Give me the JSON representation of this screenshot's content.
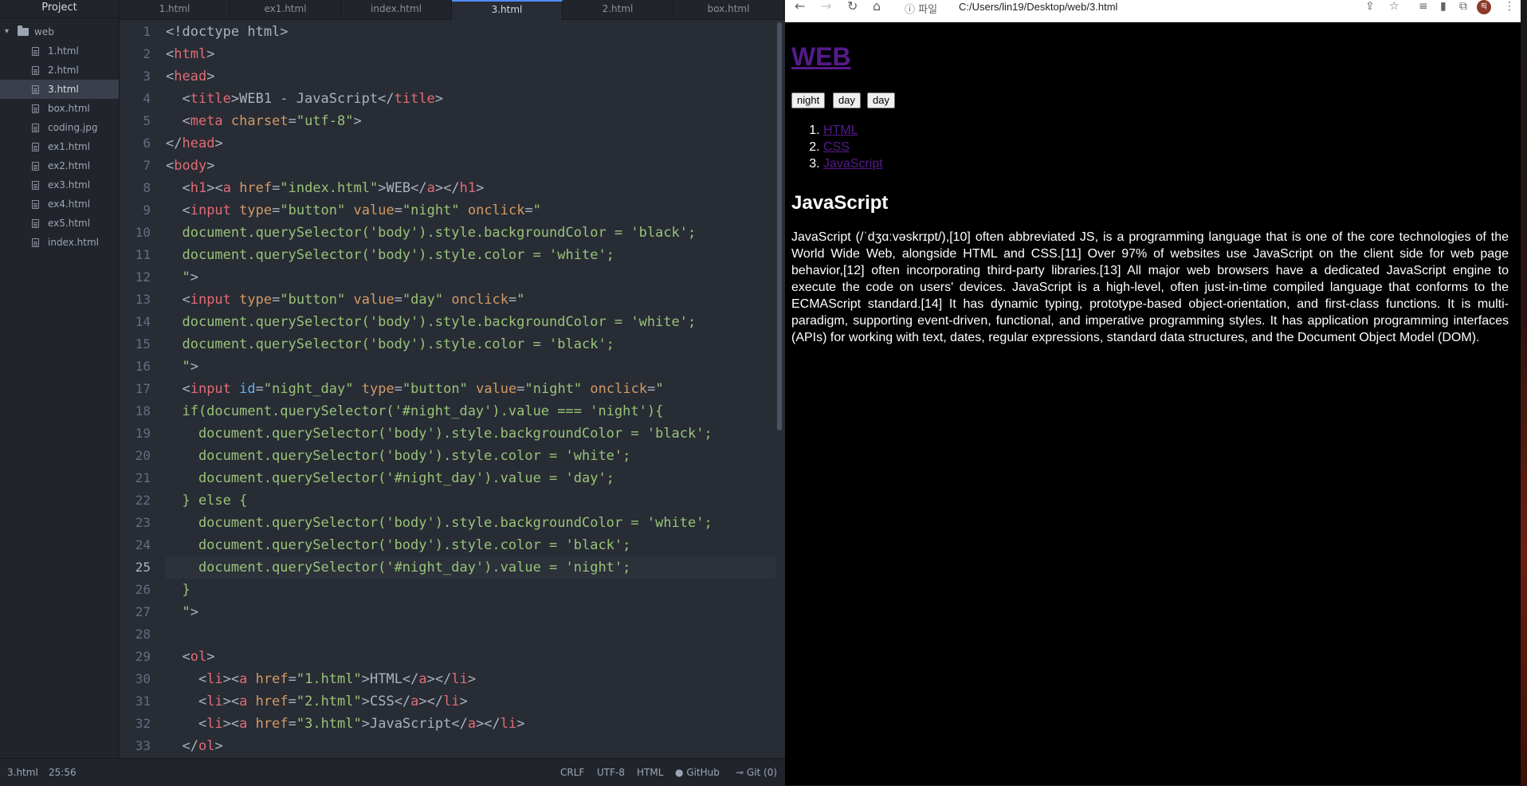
{
  "editor": {
    "tree_header": "Project",
    "folder": "web",
    "files": [
      "1.html",
      "2.html",
      "3.html",
      "box.html",
      "coding.jpg",
      "ex1.html",
      "ex2.html",
      "ex3.html",
      "ex4.html",
      "ex5.html",
      "index.html"
    ],
    "selected_file": "3.html",
    "tabs": [
      "1.html",
      "ex1.html",
      "index.html",
      "3.html",
      "2.html",
      "box.html"
    ],
    "active_tab": "3.html",
    "line_numbers": [
      "1",
      "2",
      "3",
      "4",
      "5",
      "6",
      "7",
      "8",
      "9",
      "10",
      "11",
      "12",
      "13",
      "14",
      "15",
      "16",
      "17",
      "18",
      "19",
      "20",
      "21",
      "22",
      "23",
      "24",
      "25",
      "26",
      "27",
      "28",
      "29",
      "30",
      "31",
      "32",
      "33"
    ],
    "current_line": "25",
    "code": [
      [
        [
          "pl",
          "<!doctype html>"
        ]
      ],
      [
        [
          "pl",
          "<"
        ],
        [
          "tg",
          "html"
        ],
        [
          "pl",
          ">"
        ]
      ],
      [
        [
          "pl",
          "<"
        ],
        [
          "tg",
          "head"
        ],
        [
          "pl",
          ">"
        ]
      ],
      [
        [
          "pl",
          "  <"
        ],
        [
          "tg",
          "title"
        ],
        [
          "pl",
          ">WEB1 - JavaScript</"
        ],
        [
          "tg",
          "title"
        ],
        [
          "pl",
          ">"
        ]
      ],
      [
        [
          "pl",
          "  <"
        ],
        [
          "tg",
          "meta"
        ],
        [
          "pl",
          " "
        ],
        [
          "at",
          "charset"
        ],
        [
          "pl",
          "="
        ],
        [
          "st",
          "\"utf-8\""
        ],
        [
          "pl",
          ">"
        ]
      ],
      [
        [
          "pl",
          "</"
        ],
        [
          "tg",
          "head"
        ],
        [
          "pl",
          ">"
        ]
      ],
      [
        [
          "pl",
          "<"
        ],
        [
          "tg",
          "body"
        ],
        [
          "pl",
          ">"
        ]
      ],
      [
        [
          "pl",
          "  <"
        ],
        [
          "tg",
          "h1"
        ],
        [
          "pl",
          "><"
        ],
        [
          "tg",
          "a"
        ],
        [
          "pl",
          " "
        ],
        [
          "at",
          "href"
        ],
        [
          "pl",
          "="
        ],
        [
          "st",
          "\"index.html\""
        ],
        [
          "pl",
          ">WEB</"
        ],
        [
          "tg",
          "a"
        ],
        [
          "pl",
          "></"
        ],
        [
          "tg",
          "h1"
        ],
        [
          "pl",
          ">"
        ]
      ],
      [
        [
          "pl",
          "  <"
        ],
        [
          "tg",
          "input"
        ],
        [
          "pl",
          " "
        ],
        [
          "at",
          "type"
        ],
        [
          "pl",
          "="
        ],
        [
          "st",
          "\"button\""
        ],
        [
          "pl",
          " "
        ],
        [
          "at",
          "value"
        ],
        [
          "pl",
          "="
        ],
        [
          "st",
          "\"night\""
        ],
        [
          "pl",
          " "
        ],
        [
          "at",
          "onclick"
        ],
        [
          "pl",
          "="
        ],
        [
          "st",
          "\""
        ]
      ],
      [
        [
          "st",
          "  document.querySelector('body').style.backgroundColor = 'black';"
        ]
      ],
      [
        [
          "st",
          "  document.querySelector('body').style.color = 'white';"
        ]
      ],
      [
        [
          "st",
          "  \""
        ],
        [
          "pl",
          ">"
        ]
      ],
      [
        [
          "pl",
          "  <"
        ],
        [
          "tg",
          "input"
        ],
        [
          "pl",
          " "
        ],
        [
          "at",
          "type"
        ],
        [
          "pl",
          "="
        ],
        [
          "st",
          "\"button\""
        ],
        [
          "pl",
          " "
        ],
        [
          "at",
          "value"
        ],
        [
          "pl",
          "="
        ],
        [
          "st",
          "\"day\""
        ],
        [
          "pl",
          " "
        ],
        [
          "at",
          "onclick"
        ],
        [
          "pl",
          "="
        ],
        [
          "st",
          "\""
        ]
      ],
      [
        [
          "st",
          "  document.querySelector('body').style.backgroundColor = 'white';"
        ]
      ],
      [
        [
          "st",
          "  document.querySelector('body').style.color = 'black';"
        ]
      ],
      [
        [
          "st",
          "  \""
        ],
        [
          "pl",
          ">"
        ]
      ],
      [
        [
          "pl",
          "  <"
        ],
        [
          "tg",
          "input"
        ],
        [
          "pl",
          " "
        ],
        [
          "id",
          "id"
        ],
        [
          "pl",
          "="
        ],
        [
          "st",
          "\"night_day\""
        ],
        [
          "pl",
          " "
        ],
        [
          "at",
          "type"
        ],
        [
          "pl",
          "="
        ],
        [
          "st",
          "\"button\""
        ],
        [
          "pl",
          " "
        ],
        [
          "at",
          "value"
        ],
        [
          "pl",
          "="
        ],
        [
          "st",
          "\"night\""
        ],
        [
          "pl",
          " "
        ],
        [
          "at",
          "onclick"
        ],
        [
          "pl",
          "="
        ],
        [
          "st",
          "\""
        ]
      ],
      [
        [
          "st",
          "  if(document.querySelector('#night_day').value === 'night'){"
        ]
      ],
      [
        [
          "st",
          "    document.querySelector('body').style.backgroundColor = 'black';"
        ]
      ],
      [
        [
          "st",
          "    document.querySelector('body').style.color = 'white';"
        ]
      ],
      [
        [
          "st",
          "    document.querySelector('#night_day').value = 'day';"
        ]
      ],
      [
        [
          "st",
          "  } else {"
        ]
      ],
      [
        [
          "st",
          "    document.querySelector('body').style.backgroundColor = 'white';"
        ]
      ],
      [
        [
          "st",
          "    document.querySelector('body').style.color = 'black';"
        ]
      ],
      [
        [
          "st",
          "    document.querySelector('#night_day').value = 'night';"
        ]
      ],
      [
        [
          "st",
          "  }"
        ]
      ],
      [
        [
          "st",
          "  \""
        ],
        [
          "pl",
          ">"
        ]
      ],
      [],
      [
        [
          "pl",
          "  <"
        ],
        [
          "tg",
          "ol"
        ],
        [
          "pl",
          ">"
        ]
      ],
      [
        [
          "pl",
          "    <"
        ],
        [
          "tg",
          "li"
        ],
        [
          "pl",
          "><"
        ],
        [
          "tg",
          "a"
        ],
        [
          "pl",
          " "
        ],
        [
          "at",
          "href"
        ],
        [
          "pl",
          "="
        ],
        [
          "st",
          "\"1.html\""
        ],
        [
          "pl",
          ">HTML</"
        ],
        [
          "tg",
          "a"
        ],
        [
          "pl",
          "></"
        ],
        [
          "tg",
          "li"
        ],
        [
          "pl",
          ">"
        ]
      ],
      [
        [
          "pl",
          "    <"
        ],
        [
          "tg",
          "li"
        ],
        [
          "pl",
          "><"
        ],
        [
          "tg",
          "a"
        ],
        [
          "pl",
          " "
        ],
        [
          "at",
          "href"
        ],
        [
          "pl",
          "="
        ],
        [
          "st",
          "\"2.html\""
        ],
        [
          "pl",
          ">CSS</"
        ],
        [
          "tg",
          "a"
        ],
        [
          "pl",
          "></"
        ],
        [
          "tg",
          "li"
        ],
        [
          "pl",
          ">"
        ]
      ],
      [
        [
          "pl",
          "    <"
        ],
        [
          "tg",
          "li"
        ],
        [
          "pl",
          "><"
        ],
        [
          "tg",
          "a"
        ],
        [
          "pl",
          " "
        ],
        [
          "at",
          "href"
        ],
        [
          "pl",
          "="
        ],
        [
          "st",
          "\"3.html\""
        ],
        [
          "pl",
          ">JavaScript</"
        ],
        [
          "tg",
          "a"
        ],
        [
          "pl",
          "></"
        ],
        [
          "tg",
          "li"
        ],
        [
          "pl",
          ">"
        ]
      ],
      [
        [
          "pl",
          "  </"
        ],
        [
          "tg",
          "ol"
        ],
        [
          "pl",
          ">"
        ]
      ]
    ],
    "status": {
      "file": "3.html",
      "cursor": "25:56",
      "line_ending": "CRLF",
      "encoding": "UTF-8",
      "grammar": "HTML",
      "github": "GitHub",
      "git": "Git (0)"
    }
  },
  "browser": {
    "address_info": "ⓘ 파일",
    "address": "C:/Users/lin19/Desktop/web/3.html",
    "profile_initial": "픽",
    "page": {
      "h1": "WEB",
      "buttons": [
        "night",
        "day",
        "day"
      ],
      "list": [
        "HTML",
        "CSS",
        "JavaScript"
      ],
      "h2": "JavaScript",
      "paragraph": "JavaScript (/ˈdʒɑːvəskrɪpt/),[10] often abbreviated JS, is a programming language that is one of the core technologies of the World Wide Web, alongside HTML and CSS.[11] Over 97% of websites use JavaScript on the client side for web page behavior,[12] often incorporating third-party libraries.[13] All major web browsers have a dedicated JavaScript engine to execute the code on users' devices. JavaScript is a high-level, often just-in-time compiled language that conforms to the ECMAScript standard.[14] It has dynamic typing, prototype-based object-orientation, and first-class functions. It is multi-paradigm, supporting event-driven, functional, and imperative programming styles. It has application programming interfaces (APIs) for working with text, dates, regular expressions, standard data structures, and the Document Object Model (DOM)."
    }
  },
  "colors": {
    "tag": "#e06c75",
    "attr": "#d19a66",
    "string": "#98c379",
    "id_attr": "#61afef",
    "link_visited": "#551a8b"
  }
}
